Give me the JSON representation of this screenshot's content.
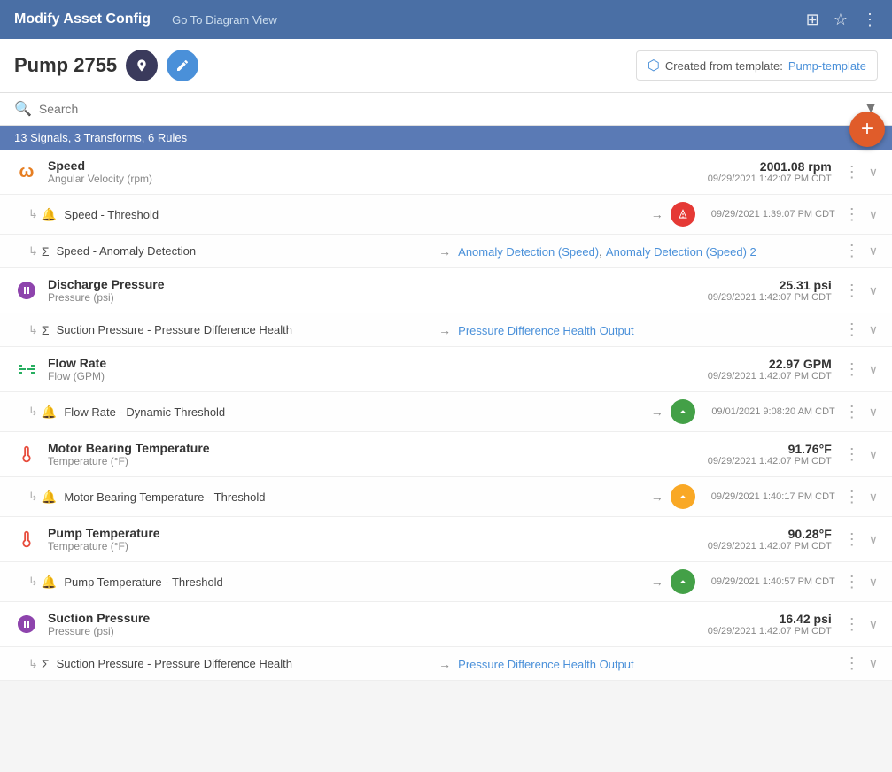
{
  "topBar": {
    "title": "Modify Asset Config",
    "linkLabel": "Go To Diagram View",
    "icons": [
      "monitor-icon",
      "star-icon",
      "menu-icon"
    ]
  },
  "assetHeader": {
    "assetName": "Pump 2755",
    "templateLabel": "Created from template:",
    "templateLink": "Pump-template"
  },
  "search": {
    "placeholder": "Search",
    "value": ""
  },
  "summaryBar": {
    "text": "13 Signals, 3 Transforms, 6 Rules"
  },
  "signals": [
    {
      "id": "speed",
      "name": "Speed",
      "unit": "Angular Velocity (rpm)",
      "value": "2001.08 rpm",
      "timestamp": "09/29/2021 1:42:07 PM CDT",
      "iconType": "omega",
      "children": [
        {
          "type": "alert",
          "name": "Speed - Threshold",
          "statusColor": "red",
          "statusIcon": "↑",
          "timestamp": "09/29/2021 1:39:07 PM CDT"
        },
        {
          "type": "transform",
          "name": "Speed - Anomaly Detection",
          "links": [
            "Anomaly Detection (Speed)",
            "Anomaly Detection (Speed) 2"
          ],
          "timestamp": ""
        }
      ]
    },
    {
      "id": "discharge-pressure",
      "name": "Discharge Pressure",
      "unit": "Pressure (psi)",
      "value": "25.31 psi",
      "timestamp": "09/29/2021 1:42:07 PM CDT",
      "iconType": "gauge",
      "children": [
        {
          "type": "transform",
          "name": "Suction Pressure - Pressure Difference Health",
          "links": [
            "Pressure Difference Health Output"
          ],
          "timestamp": ""
        }
      ]
    },
    {
      "id": "flow-rate",
      "name": "Flow Rate",
      "unit": "Flow (GPM)",
      "value": "22.97 GPM",
      "timestamp": "09/29/2021 1:42:07 PM CDT",
      "iconType": "flow",
      "children": [
        {
          "type": "alert",
          "name": "Flow Rate - Dynamic Threshold",
          "statusColor": "green",
          "statusIcon": "↑",
          "timestamp": "09/01/2021 9:08:20 AM CDT"
        }
      ]
    },
    {
      "id": "motor-bearing-temp",
      "name": "Motor Bearing Temperature",
      "unit": "Temperature (°F)",
      "value": "91.76°F",
      "timestamp": "09/29/2021 1:42:07 PM CDT",
      "iconType": "therm",
      "children": [
        {
          "type": "alert",
          "name": "Motor Bearing Temperature - Threshold",
          "statusColor": "yellow",
          "statusIcon": "↑",
          "timestamp": "09/29/2021 1:40:17 PM CDT"
        }
      ]
    },
    {
      "id": "pump-temp",
      "name": "Pump Temperature",
      "unit": "Temperature (°F)",
      "value": "90.28°F",
      "timestamp": "09/29/2021 1:42:07 PM CDT",
      "iconType": "therm",
      "children": [
        {
          "type": "alert",
          "name": "Pump Temperature - Threshold",
          "statusColor": "green",
          "statusIcon": "↑",
          "timestamp": "09/29/2021 1:40:57 PM CDT"
        }
      ]
    },
    {
      "id": "suction-pressure",
      "name": "Suction Pressure",
      "unit": "Pressure (psi)",
      "value": "16.42 psi",
      "timestamp": "09/29/2021 1:42:07 PM CDT",
      "iconType": "gauge",
      "children": [
        {
          "type": "transform",
          "name": "Suction Pressure - Pressure Difference Health",
          "links": [
            "Pressure Difference Health Output"
          ],
          "timestamp": ""
        }
      ]
    }
  ]
}
